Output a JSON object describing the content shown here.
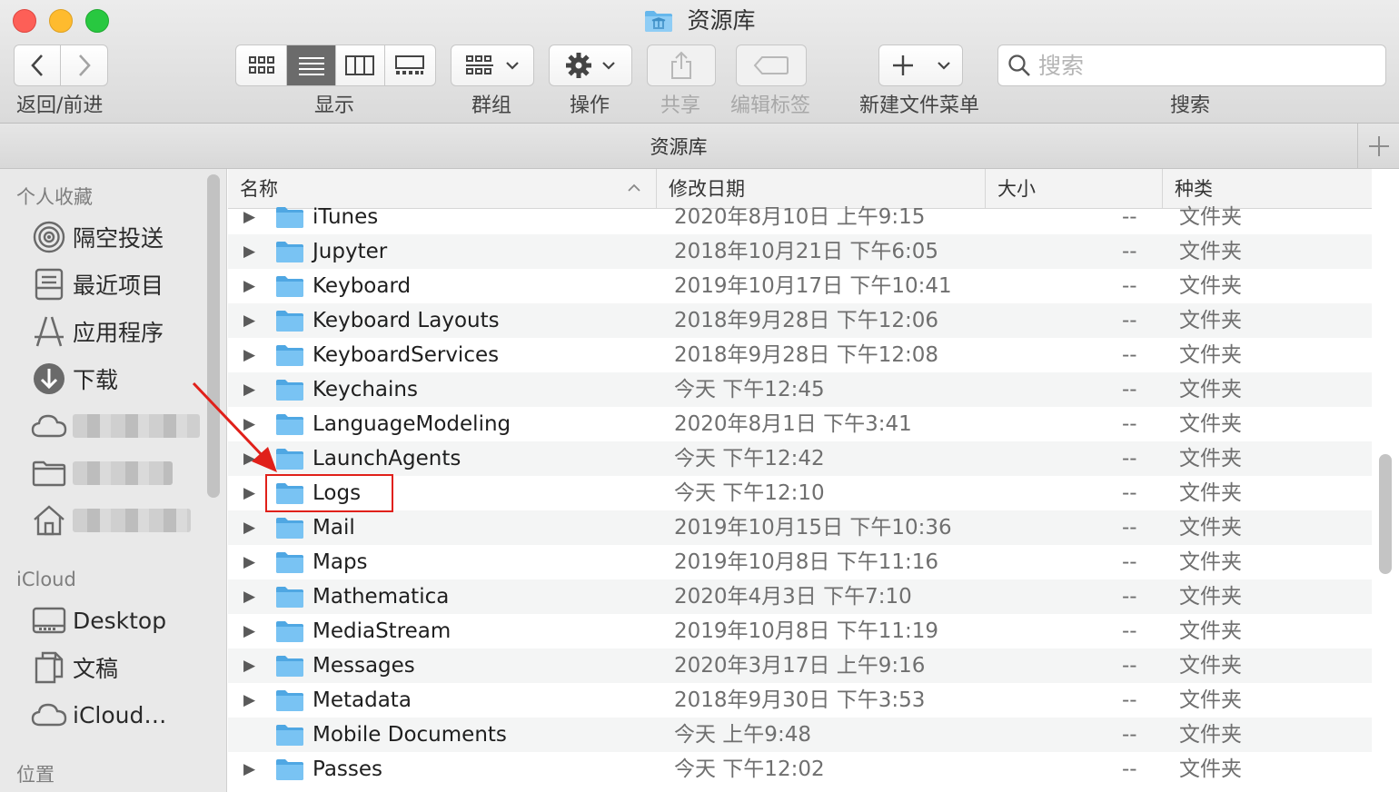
{
  "window": {
    "title": "资源库"
  },
  "toolbar": {
    "back_forward_label": "返回/前进",
    "view_label": "显示",
    "group_label": "群组",
    "action_label": "操作",
    "share_label": "共享",
    "edit_tags_label": "编辑标签",
    "new_menu_label": "新建文件菜单",
    "search_label": "搜索",
    "search_placeholder": "搜索"
  },
  "pathbar": {
    "title": "资源库"
  },
  "sidebar": {
    "favorites_header": "个人收藏",
    "favorites": [
      {
        "label": "隔空投送",
        "icon": "airdrop-icon"
      },
      {
        "label": "最近项目",
        "icon": "recents-icon"
      },
      {
        "label": "应用程序",
        "icon": "applications-icon"
      },
      {
        "label": "下载",
        "icon": "downloads-icon"
      }
    ],
    "icloud_header": "iCloud",
    "icloud": [
      {
        "label": "Desktop",
        "icon": "desktop-icon"
      },
      {
        "label": "文稿",
        "icon": "documents-icon"
      },
      {
        "label": "iCloud…",
        "icon": "icloud-drive-icon"
      }
    ],
    "locations_header": "位置"
  },
  "columns": {
    "name": "名称",
    "modified": "修改日期",
    "size": "大小",
    "kind": "种类"
  },
  "files": [
    {
      "name": "iTunes",
      "modified": "2020年8月10日 上午9:15",
      "size": "--",
      "kind": "文件夹",
      "expandable": true
    },
    {
      "name": "Jupyter",
      "modified": "2018年10月21日 下午6:05",
      "size": "--",
      "kind": "文件夹",
      "expandable": true
    },
    {
      "name": "Keyboard",
      "modified": "2019年10月17日 下午10:41",
      "size": "--",
      "kind": "文件夹",
      "expandable": true
    },
    {
      "name": "Keyboard Layouts",
      "modified": "2018年9月28日 下午12:06",
      "size": "--",
      "kind": "文件夹",
      "expandable": true
    },
    {
      "name": "KeyboardServices",
      "modified": "2018年9月28日 下午12:08",
      "size": "--",
      "kind": "文件夹",
      "expandable": true
    },
    {
      "name": "Keychains",
      "modified": "今天 下午12:45",
      "size": "--",
      "kind": "文件夹",
      "expandable": true
    },
    {
      "name": "LanguageModeling",
      "modified": "2020年8月1日 下午3:41",
      "size": "--",
      "kind": "文件夹",
      "expandable": true
    },
    {
      "name": "LaunchAgents",
      "modified": "今天 下午12:42",
      "size": "--",
      "kind": "文件夹",
      "expandable": true
    },
    {
      "name": "Logs",
      "modified": "今天 下午12:10",
      "size": "--",
      "kind": "文件夹",
      "expandable": true
    },
    {
      "name": "Mail",
      "modified": "2019年10月15日 下午10:36",
      "size": "--",
      "kind": "文件夹",
      "expandable": true
    },
    {
      "name": "Maps",
      "modified": "2019年10月8日 下午11:16",
      "size": "--",
      "kind": "文件夹",
      "expandable": true
    },
    {
      "name": "Mathematica",
      "modified": "2020年4月3日 下午7:10",
      "size": "--",
      "kind": "文件夹",
      "expandable": true
    },
    {
      "name": "MediaStream",
      "modified": "2019年10月8日 下午11:19",
      "size": "--",
      "kind": "文件夹",
      "expandable": true
    },
    {
      "name": "Messages",
      "modified": "2020年3月17日 上午9:16",
      "size": "--",
      "kind": "文件夹",
      "expandable": true
    },
    {
      "name": "Metadata",
      "modified": "2018年9月30日 下午3:53",
      "size": "--",
      "kind": "文件夹",
      "expandable": true
    },
    {
      "name": "Mobile Documents",
      "modified": "今天 上午9:48",
      "size": "--",
      "kind": "文件夹",
      "expandable": false
    },
    {
      "name": "Passes",
      "modified": "今天 下午12:02",
      "size": "--",
      "kind": "文件夹",
      "expandable": true
    }
  ],
  "colors": {
    "folder": "#66b7ec",
    "highlight_box": "#e0201a",
    "arrow": "#e0201a"
  }
}
